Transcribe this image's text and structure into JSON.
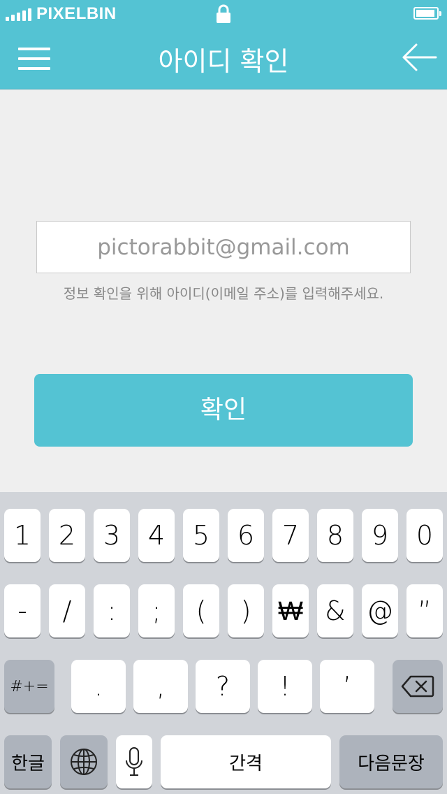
{
  "status_bar": {
    "carrier": "PIXELBIN",
    "icons": [
      "signal-icon",
      "lock-icon",
      "battery-icon"
    ]
  },
  "header": {
    "title": "아이디 확인",
    "menu_icon": "hamburger-menu-icon",
    "back_icon": "back-arrow-icon",
    "background": "#54c3d3"
  },
  "form": {
    "email_value": "pictorabbit@gmail.com",
    "hint": "정보 확인을 위해 아이디(이메일 주소)를 입력해주세요.",
    "confirm_label": "확인"
  },
  "keyboard": {
    "row1": [
      "1",
      "2",
      "3",
      "4",
      "5",
      "6",
      "7",
      "8",
      "9",
      "0"
    ],
    "row2": [
      "-",
      "/",
      ":",
      ";",
      "(",
      ")",
      "₩",
      "&",
      "@",
      "”"
    ],
    "row3": {
      "toggle": "#+=",
      "keys": [
        ".",
        ",",
        "?",
        "!",
        "’"
      ],
      "delete_icon": "backspace-icon"
    },
    "row4": {
      "lang": "한글",
      "globe_icon": "globe-icon",
      "mic_icon": "microphone-icon",
      "space": "간격",
      "next": "다음문장"
    }
  }
}
